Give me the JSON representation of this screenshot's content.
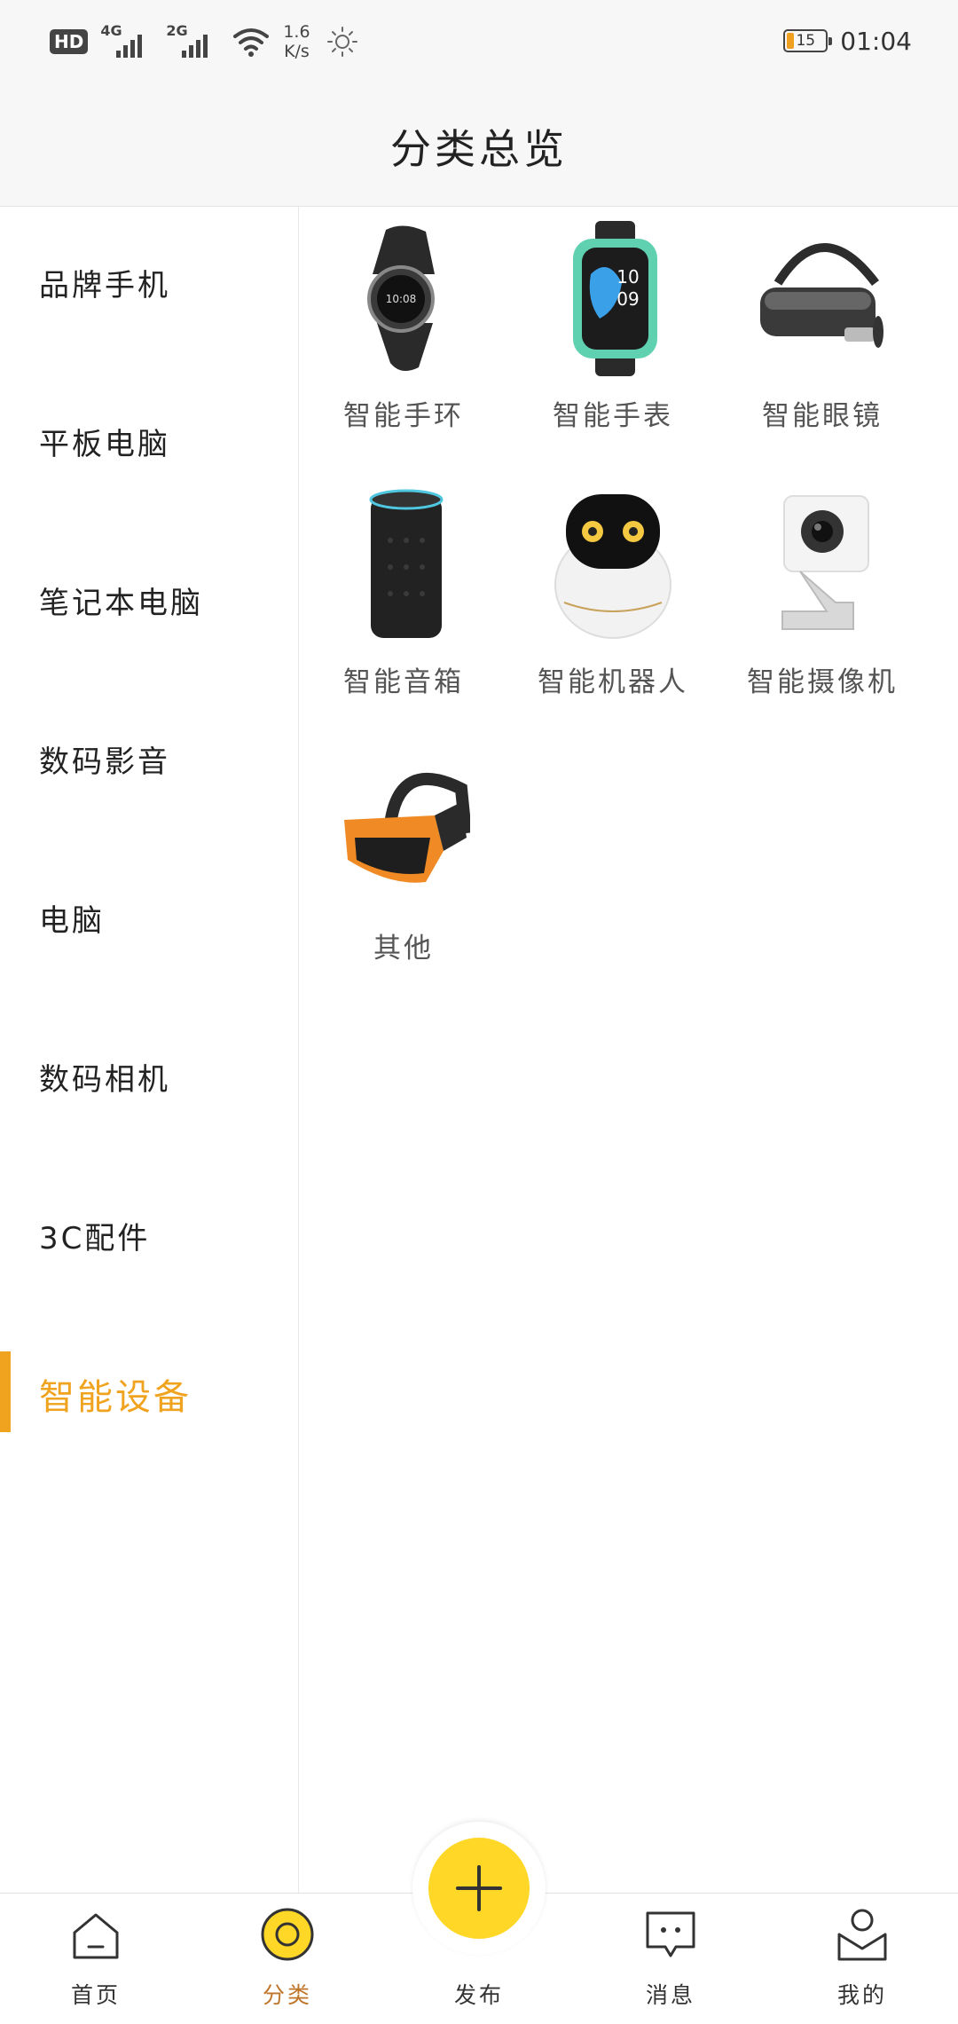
{
  "status_bar": {
    "hd": "HD",
    "sim1_gen": "4G",
    "sim2_gen": "2G",
    "speed_value": "1.6",
    "speed_unit": "K/s",
    "battery_level": "15",
    "time": "01:04"
  },
  "header": {
    "title": "分类总览"
  },
  "sidebar": {
    "items": [
      {
        "label": "品牌手机",
        "active": false
      },
      {
        "label": "平板电脑",
        "active": false
      },
      {
        "label": "笔记本电脑",
        "active": false
      },
      {
        "label": "数码影音",
        "active": false
      },
      {
        "label": "电脑",
        "active": false
      },
      {
        "label": "数码相机",
        "active": false
      },
      {
        "label": "3C配件",
        "active": false
      },
      {
        "label": "智能设备",
        "active": true
      }
    ]
  },
  "grid": {
    "items": [
      {
        "label": "智能手环",
        "icon": "smart-band-icon"
      },
      {
        "label": "智能手表",
        "icon": "smart-watch-icon"
      },
      {
        "label": "智能眼镜",
        "icon": "vr-headset-icon"
      },
      {
        "label": "智能音箱",
        "icon": "smart-speaker-icon"
      },
      {
        "label": "智能机器人",
        "icon": "robot-icon"
      },
      {
        "label": "智能摄像机",
        "icon": "camera-icon"
      },
      {
        "label": "其他",
        "icon": "orange-vr-headset-icon"
      }
    ]
  },
  "bottom_nav": {
    "items": [
      {
        "label": "首页",
        "icon": "home-icon"
      },
      {
        "label": "分类",
        "icon": "category-icon",
        "active": true
      },
      {
        "label": "发布",
        "icon": "add-icon"
      },
      {
        "label": "消息",
        "icon": "message-icon"
      },
      {
        "label": "我的",
        "icon": "profile-icon"
      }
    ]
  },
  "colors": {
    "accent": "#f0a31e",
    "fab": "#ffd726",
    "header_bg": "#f7f7f7"
  }
}
